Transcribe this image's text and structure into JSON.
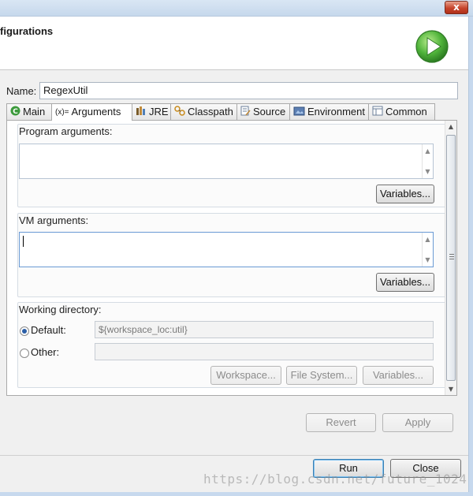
{
  "window": {
    "close_glyph": "x"
  },
  "header": {
    "title": "figurations",
    "logo_icon": "run-launch-icon",
    "logo_color": "#3aa03a"
  },
  "name": {
    "label": "Name:",
    "value": "RegexUtil"
  },
  "tabs": [
    {
      "label": "Main",
      "icon": "main-icon",
      "active": false
    },
    {
      "label": "Arguments",
      "icon": "arguments-icon",
      "icon_text": "(x)=",
      "active": true
    },
    {
      "label": "JRE",
      "icon": "jre-icon",
      "active": false
    },
    {
      "label": "Classpath",
      "icon": "classpath-icon",
      "active": false
    },
    {
      "label": "Source",
      "icon": "source-icon",
      "active": false
    },
    {
      "label": "Environment",
      "icon": "environment-icon",
      "active": false
    },
    {
      "label": "Common",
      "icon": "common-icon",
      "active": false
    }
  ],
  "program_args": {
    "title": "Program arguments:",
    "value": "",
    "variables_label": "Variables..."
  },
  "vm_args": {
    "title": "VM arguments:",
    "value": "",
    "variables_label": "Variables..."
  },
  "working_dir": {
    "title": "Working directory:",
    "default_label": "Default:",
    "default_value": "${workspace_loc:util}",
    "default_checked": true,
    "other_label": "Other:",
    "other_value": "",
    "workspace_label": "Workspace...",
    "filesystem_label": "File System...",
    "variables_label": "Variables..."
  },
  "actions": {
    "revert_label": "Revert",
    "apply_label": "Apply"
  },
  "footer": {
    "run_label": "Run",
    "close_label": "Close"
  },
  "watermark": "https://blog.csdn.net/future_1024"
}
